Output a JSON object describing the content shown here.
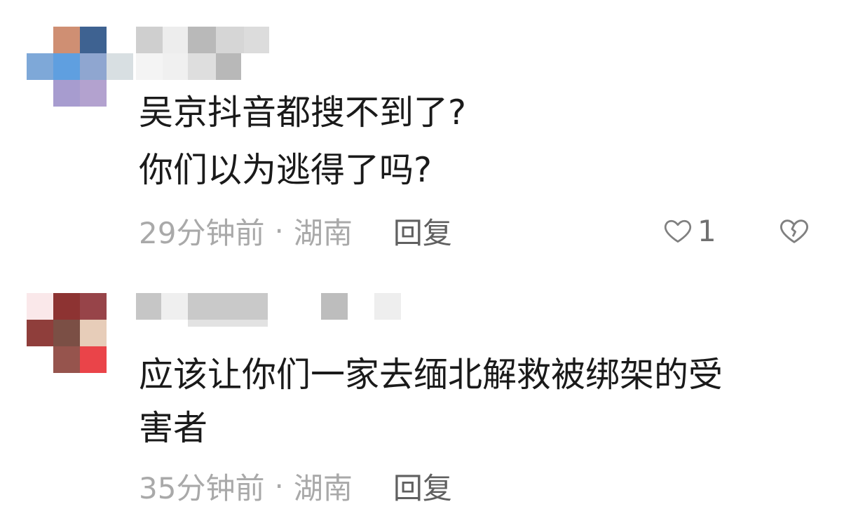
{
  "comments": [
    {
      "text_lines": [
        "吴京抖音都搜不到了?",
        "你们以为逃得了吗?"
      ],
      "time": "29分钟前",
      "separator": "·",
      "location": "湖南",
      "reply_label": "回复",
      "like_count": "1",
      "icons": {
        "like": "heart-outline-icon",
        "dislike": "broken-heart-icon"
      },
      "avatar_colors": [
        "#cf8f73",
        "#3e6291",
        "#7ea8d8",
        "#5f9fe0",
        "#8fa6d0",
        "#d8dfe2",
        "#a79ccf",
        "#b3a2cf"
      ]
    },
    {
      "text_lines": [
        "应该让你们一家去缅北解救被绑架的受",
        "害者"
      ],
      "time": "35分钟前",
      "separator": "·",
      "location": "湖南",
      "reply_label": "回复",
      "avatar_colors": [
        "#fae8ea",
        "#8d3332",
        "#974449",
        "#8f3e3b",
        "#7b4f45",
        "#e7cdb9",
        "#96544d",
        "#ea4449"
      ]
    }
  ]
}
